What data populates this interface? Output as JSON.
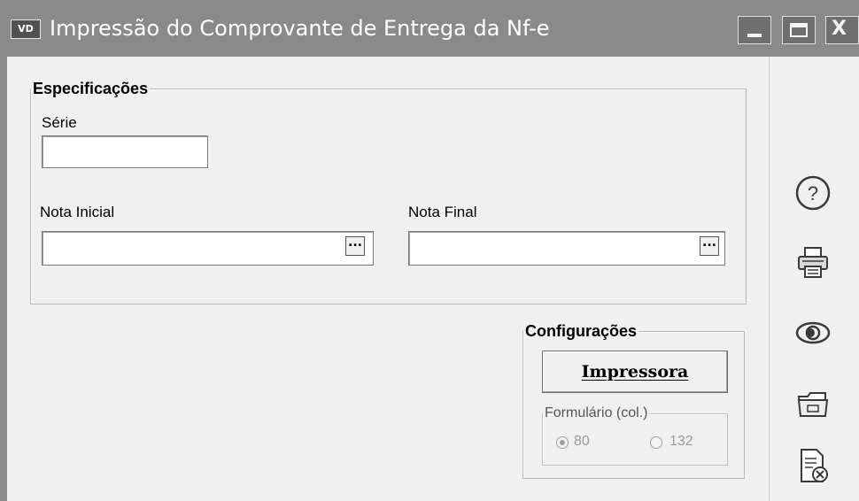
{
  "window": {
    "title": "Impressão do Comprovante de Entrega da Nf-e",
    "app_icon_text": "VD"
  },
  "especificacoes": {
    "legend": "Especificações",
    "serie_label": "Série",
    "serie_value": "",
    "nota_inicial_label": "Nota Inicial",
    "nota_inicial_value": "",
    "nota_final_label": "Nota Final",
    "nota_final_value": "",
    "lookup_label": "..."
  },
  "configuracoes": {
    "legend": "Configurações",
    "impressora_button": "Impressora",
    "formulario_legend": "Formulário (col.)",
    "options": [
      "80",
      "132"
    ],
    "selected": "80"
  },
  "toolbar": {
    "icons": [
      "help-icon",
      "printer-icon",
      "preview-eye-icon",
      "folder-icon",
      "close-document-icon"
    ],
    "colors": {
      "icon_stroke": "#3a3a3a",
      "titlebar": "#8a8a8a"
    }
  }
}
